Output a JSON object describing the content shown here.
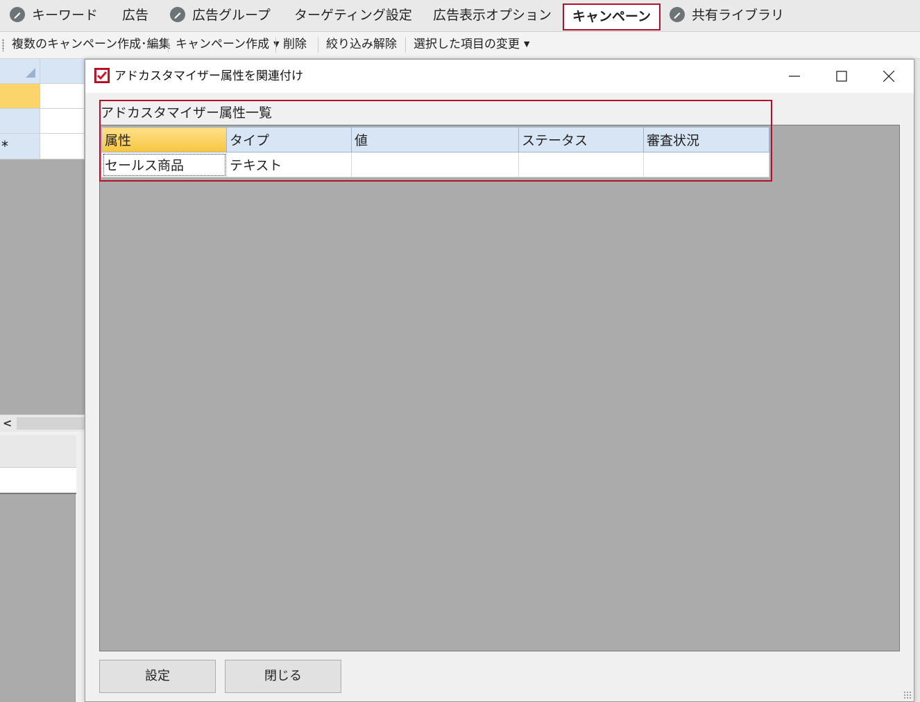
{
  "tabs": [
    {
      "label": "キーワード",
      "icon": "pencil-icon"
    },
    {
      "label": "広告",
      "icon": null
    },
    {
      "label": "広告グループ",
      "icon": "pencil-icon"
    },
    {
      "label": "ターゲティング設定",
      "icon": null
    },
    {
      "label": "広告表示オプション",
      "icon": null
    },
    {
      "label": "キャンペーン",
      "icon": null,
      "active": true
    },
    {
      "label": "共有ライブラリ",
      "icon": "pencil-icon"
    }
  ],
  "toolbar": {
    "items": [
      "複数のキャンペーン作成･編集",
      "キャンペーン作成",
      "削除",
      "絞り込み解除",
      "選択した項目の変更"
    ]
  },
  "background": {
    "new_row_marker": "*",
    "scroll_arrow": "<"
  },
  "dialog": {
    "title": "アドカスタマイザー属性を関連付け",
    "section_title": "アドカスタマイザー属性一覧",
    "columns": [
      "属性",
      "タイプ",
      "値",
      "ステータス",
      "審査状況"
    ],
    "rows": [
      [
        "セールス商品",
        "テキスト",
        "",
        "",
        ""
      ]
    ],
    "ok_label": "設定",
    "close_label": "閉じる"
  },
  "colors": {
    "highlight_border": "#b0102a",
    "header_bg": "#d7e5f5",
    "selected_header_bg": "#f7c640",
    "grid_empty_bg": "#ababab"
  }
}
